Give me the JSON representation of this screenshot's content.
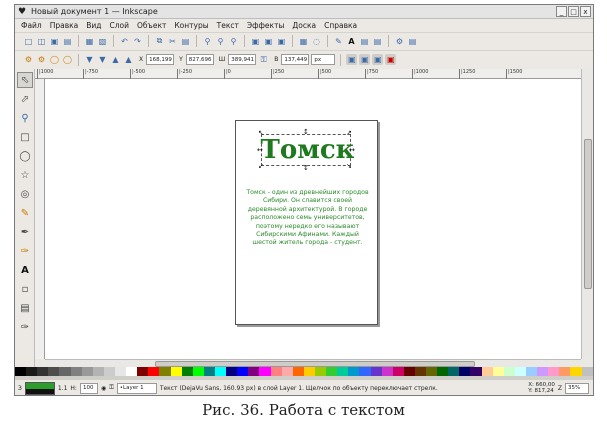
{
  "window": {
    "title": "Новый документ 1 — Inkscape",
    "controls": [
      "_",
      "□",
      "x"
    ]
  },
  "menu": [
    "Файл",
    "Правка",
    "Вид",
    "Слой",
    "Объект",
    "Контуры",
    "Текст",
    "Эффекты",
    "Доска",
    "Справка"
  ],
  "toolbar2": {
    "x_label": "X",
    "x_value": "168,199",
    "y_label": "Y",
    "y_value": "827,696",
    "w_label": "Ш",
    "w_value": "389,941",
    "h_label": "В",
    "h_value": "137,449",
    "unit": "px"
  },
  "ruler": {
    "labels": [
      "|1000",
      "|-750",
      "|-500",
      "|-250",
      "|0",
      "|250",
      "|500",
      "|750",
      "|1000",
      "|1250",
      "|1500"
    ]
  },
  "document": {
    "headline": "Томск",
    "body": "Томск - один из древнейших городов Сибири. Он славится своей деревянной архитектурой. В городе расположено семь университетов, поэтому нередко его называют Сибирскими Афинами. Каждый шестой житель города - студент.",
    "headline_color": "#1f7a1f",
    "body_color": "#2a8a2a"
  },
  "status": {
    "opacity_label": "Н:",
    "opacity_value": "100",
    "layer": "•Layer 1",
    "message": "Текст (DejaVu Sans, 160.93 px) в слой Layer 1. Щелчок по объекту переключает стрелк.",
    "coords_x": "X: 660,00",
    "coords_y": "Y: 817,24",
    "zoom": "35%",
    "fill_label": "З",
    "stroke_label": "О",
    "stroke_width": "1.1"
  },
  "caption": "Рис. 36. Работа с текстом",
  "palette": [
    "#000000",
    "#1a1a1a",
    "#333333",
    "#4d4d4d",
    "#666666",
    "#808080",
    "#999999",
    "#b3b3b3",
    "#cccccc",
    "#e6e6e6",
    "#ffffff",
    "#800000",
    "#ff0000",
    "#808000",
    "#ffff00",
    "#008000",
    "#00ff00",
    "#008080",
    "#00ffff",
    "#000080",
    "#0000ff",
    "#800080",
    "#ff00ff",
    "#ff8080",
    "#ffaaaa",
    "#ff6600",
    "#ffcc00",
    "#99cc00",
    "#33cc33",
    "#00cc99",
    "#0099cc",
    "#3366ff",
    "#6633cc",
    "#cc33cc",
    "#cc0066",
    "#660000",
    "#663300",
    "#666600",
    "#006600",
    "#006666",
    "#000066",
    "#330066",
    "#ffcc99",
    "#ffff99",
    "#ccffcc",
    "#ccffff",
    "#99ccff",
    "#cc99ff",
    "#ff99cc",
    "#ff9966",
    "#ffd700",
    "#c0c0c0"
  ]
}
